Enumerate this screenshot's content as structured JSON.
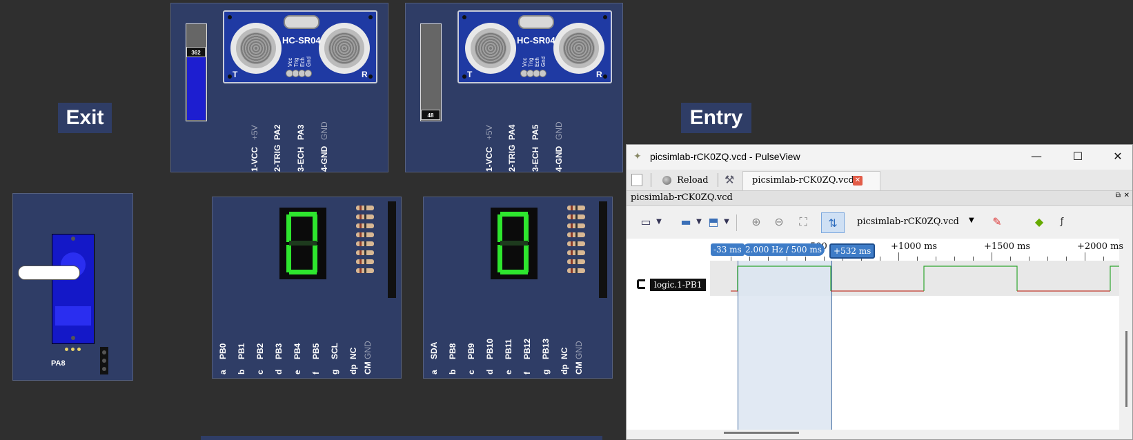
{
  "labels": {
    "exit": "Exit",
    "entry": "Entry"
  },
  "sensor_left": {
    "module_name": "HC-SR04",
    "pin_tiny": [
      "Vcc",
      "Trig",
      "Ech",
      "Gnd"
    ],
    "corner_left": "T",
    "corner_right": "R",
    "slider_value": "362",
    "slider_level": 0.75,
    "pins": [
      "1-VCC",
      "2-TRIG",
      "3-ECH",
      "4-GND"
    ],
    "pin_targets": [
      "+5V",
      "PA2",
      "PA3",
      "GND"
    ]
  },
  "sensor_right": {
    "module_name": "HC-SR04",
    "pin_tiny": [
      "Vcc",
      "Trig",
      "Ech",
      "Gnd"
    ],
    "corner_left": "T",
    "corner_right": "R",
    "slider_value": "48",
    "slider_level": 0.1,
    "pins": [
      "1-VCC",
      "2-TRIG",
      "3-ECH",
      "4-GND"
    ],
    "pin_targets": [
      "+5V",
      "PA4",
      "PA5",
      "GND"
    ]
  },
  "servo": {
    "pin_label": "PA8"
  },
  "display_left": {
    "digit": "0",
    "pins": [
      "a",
      "b",
      "c",
      "d",
      "e",
      "f",
      "g",
      "dp",
      "CM"
    ],
    "pin_targets": [
      "PB0",
      "PB1",
      "PB2",
      "PB3",
      "PB4",
      "PB5",
      "SCL",
      "NC",
      "GND"
    ]
  },
  "display_right": {
    "digit": "0",
    "pins": [
      "a",
      "b",
      "c",
      "d",
      "e",
      "f",
      "g",
      "dp",
      "CM"
    ],
    "pin_targets": [
      "SDA",
      "PB8",
      "PB9",
      "PB10",
      "PB11",
      "PB12",
      "PB13",
      "NC",
      "GND"
    ]
  },
  "pulseview": {
    "window_title": "picsimlab-rCK0ZQ.vcd - PulseView",
    "reload_label": "Reload",
    "tab_label": "picsimlab-rCK0ZQ.vcd",
    "doc_title": "picsimlab-rCK0ZQ.vcd",
    "device_select": "picsimlab-rCK0ZQ.vcd",
    "ruler": {
      "left_marker": "-33 ms",
      "measure": "2.000 Hz / 500 ms",
      "partial_tick": "500",
      "right_marker": "+532 ms",
      "ticks": [
        "+1000 ms",
        "+1500 ms",
        "+2000 ms"
      ]
    },
    "channel_name": "logic.1-PB1",
    "colors": {
      "accent": "#3e7cc7",
      "high": "#2da52d",
      "low": "#c0392b",
      "selection": "#dce6f2"
    }
  }
}
